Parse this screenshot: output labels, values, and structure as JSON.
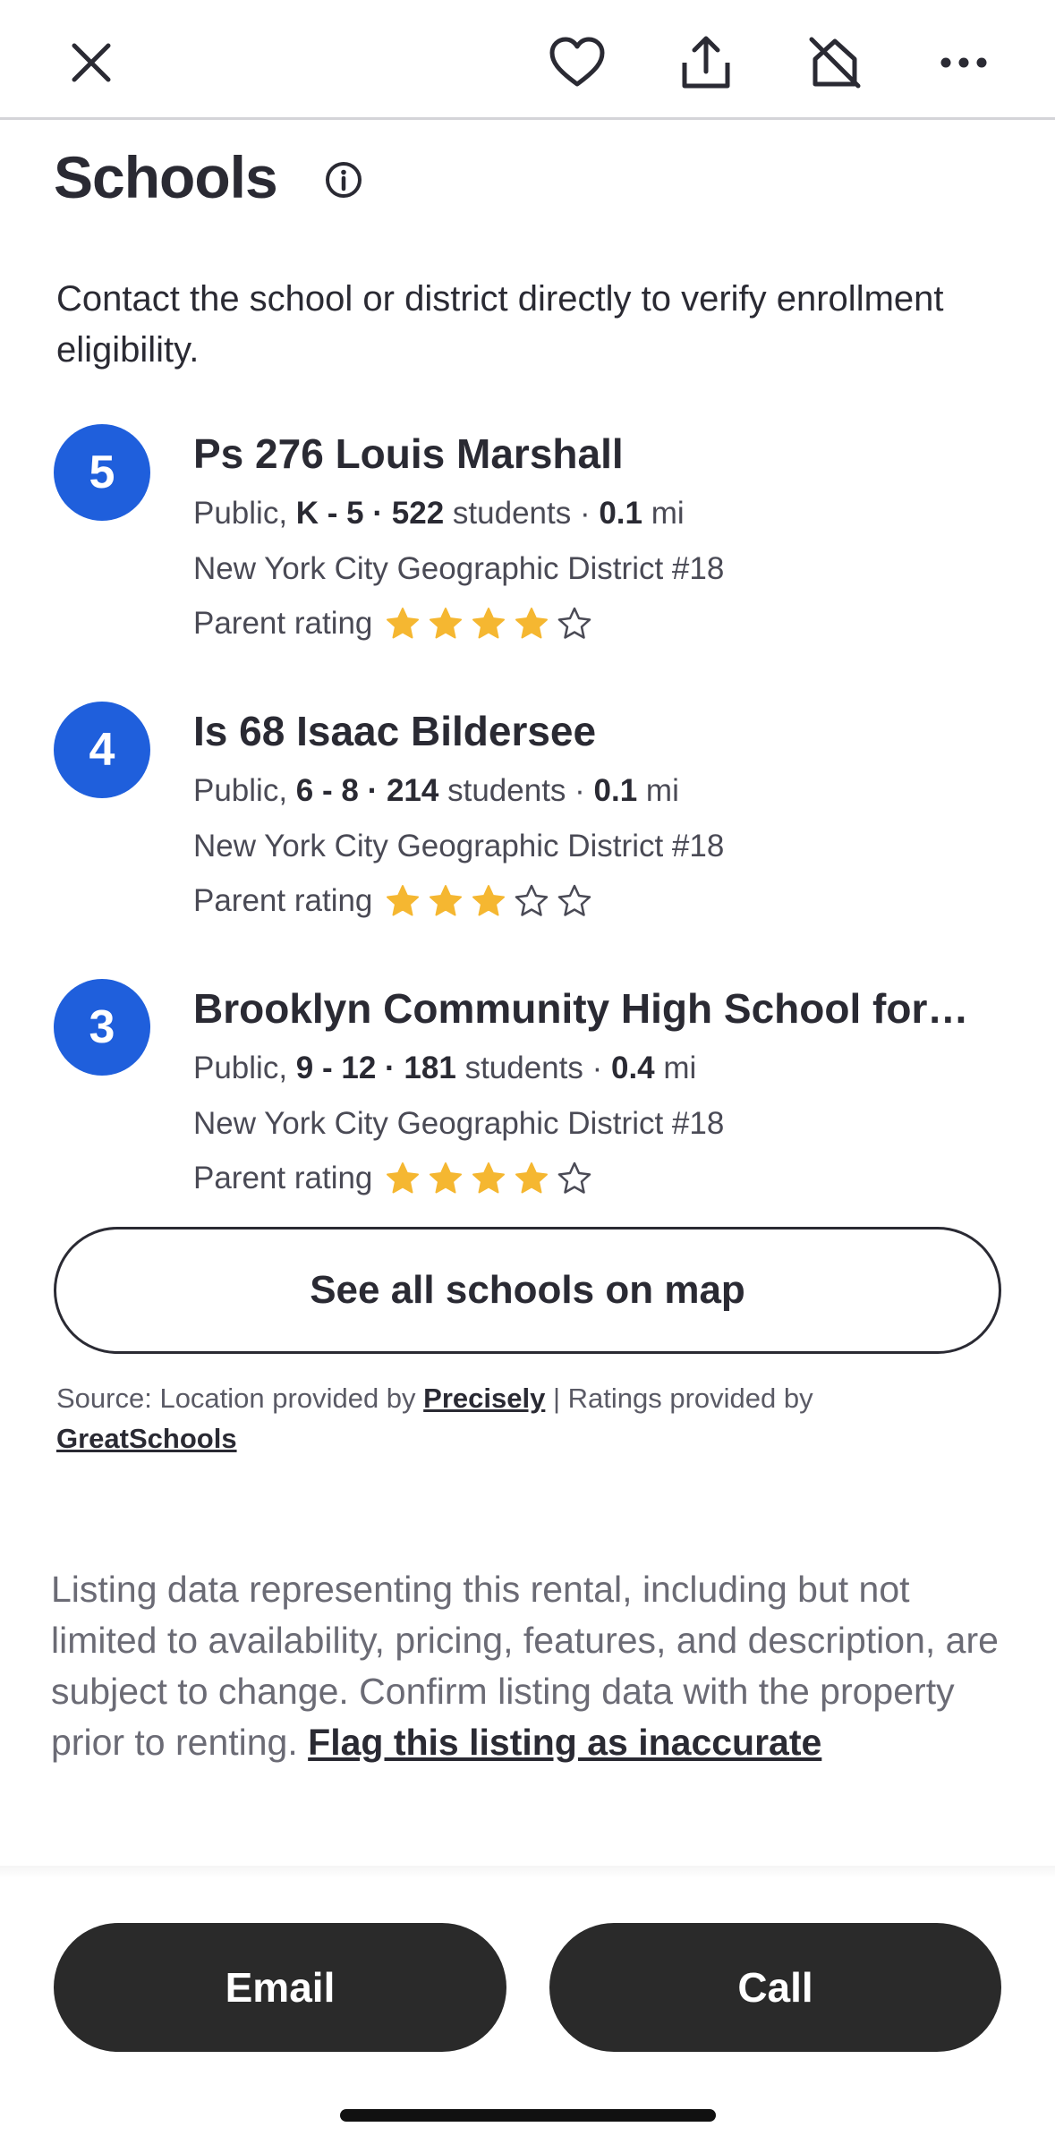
{
  "topbar": {
    "icons": [
      "close-icon",
      "heart-icon",
      "share-icon",
      "hide-home-icon",
      "more-icon"
    ]
  },
  "section": {
    "title": "Schools",
    "info_icon": "info-icon",
    "intro": "Contact the school or district directly to verify enrollment eligibility."
  },
  "schools": [
    {
      "rating": "5",
      "name": "Ps 276 Louis Marshall",
      "type": "Public,",
      "grades": "K - 5",
      "students": "522",
      "students_label": "students",
      "distance": "0.1",
      "distance_unit": "mi",
      "district": "New York City Geographic District #18",
      "parent_label": "Parent rating",
      "stars": 4
    },
    {
      "rating": "4",
      "name": "Is 68 Isaac Bildersee",
      "type": "Public,",
      "grades": "6 - 8",
      "students": "214",
      "students_label": "students",
      "distance": "0.1",
      "distance_unit": "mi",
      "district": "New York City Geographic District #18",
      "parent_label": "Parent rating",
      "stars": 3
    },
    {
      "rating": "3",
      "name": "Brooklyn Community High School for…",
      "type": "Public,",
      "grades": "9 - 12",
      "students": "181",
      "students_label": "students",
      "distance": "0.4",
      "distance_unit": "mi",
      "district": "New York City Geographic District #18",
      "parent_label": "Parent rating",
      "stars": 4
    }
  ],
  "see_all": "See all schools on map",
  "source": {
    "prefix": "Source: Location provided by",
    "link1": "Precisely",
    "middle": "| Ratings provided by",
    "link2": "GreatSchools"
  },
  "disclaimer": {
    "text": "Listing data representing this rental, including but not limited to availability, pricing, features, and description, are subject to change. Confirm listing data with the property prior to renting.",
    "link": "Flag this listing as inaccurate"
  },
  "actions": {
    "email": "Email",
    "call": "Call"
  },
  "colors": {
    "badge": "#1f5fdc",
    "star_filled": "#f5b731",
    "button_dark": "#2a2a2a"
  }
}
